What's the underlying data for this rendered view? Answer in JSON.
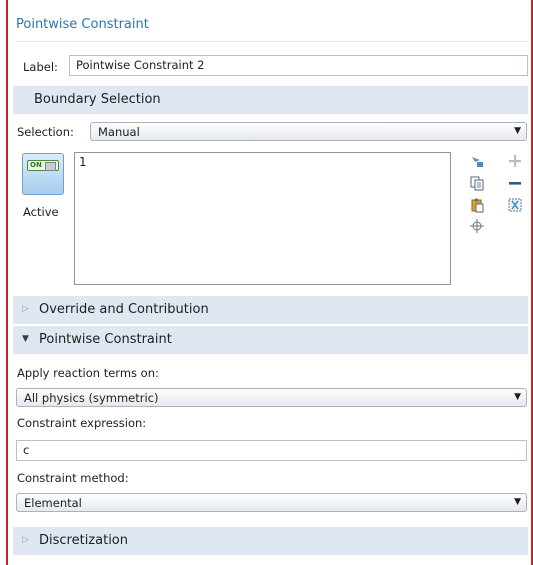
{
  "panel": {
    "title": "Pointwise Constraint",
    "label_caption": "Label:",
    "label_value": "Pointwise Constraint 2"
  },
  "boundary_selection": {
    "title": "Boundary Selection",
    "selection_caption": "Selection:",
    "selection_value": "Manual",
    "active_caption": "Active",
    "toggle_text": "ON",
    "items": [
      "1"
    ],
    "icons": [
      "select-boundaries-icon",
      "add-icon",
      "copy-selection-icon",
      "remove-icon",
      "paste-selection-icon",
      "clear-selection-icon",
      "zoom-to-selection-icon"
    ]
  },
  "override_section": {
    "title": "Override and Contribution",
    "expanded": false
  },
  "pointwise_section": {
    "title": "Pointwise Constraint",
    "expanded": true,
    "apply_caption": "Apply reaction terms on:",
    "apply_value": "All physics (symmetric)",
    "expr_caption": "Constraint expression:",
    "expr_value": "c",
    "method_caption": "Constraint method:",
    "method_value": "Elemental"
  },
  "discretization_section": {
    "title": "Discretization",
    "expanded": false
  },
  "colors": {
    "title_blue": "#2c74b3",
    "section_bg": "#dfe8f2",
    "frame_red": "#c0262b"
  }
}
